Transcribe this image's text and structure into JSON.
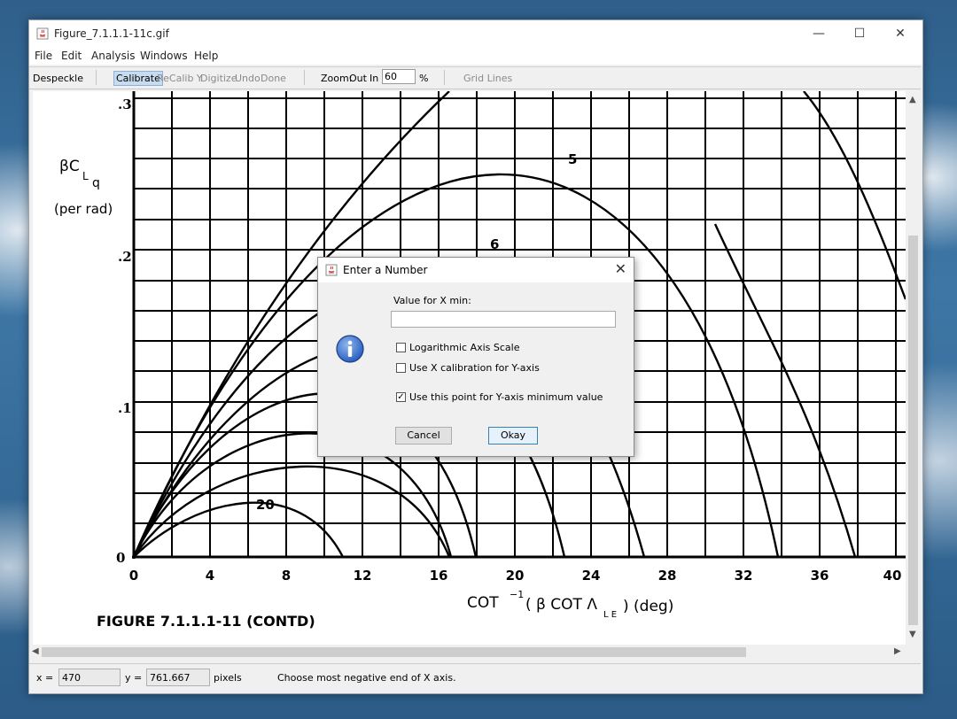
{
  "window": {
    "title": "Figure_7.1.1.1-11c.gif"
  },
  "window_controls": {
    "minimize": "—",
    "maximize": "☐",
    "close": "✕"
  },
  "menu": [
    "File",
    "Edit",
    "Analysis",
    "Windows",
    "Help"
  ],
  "toolbar": {
    "despeckle": "Despeckle",
    "calibrate": "Calibrate",
    "recalib_y": "ReCalib Y",
    "digitize": "Digitize",
    "undo": "Undo",
    "done": "Done",
    "zoom_label": "Zoom:",
    "zoom_out": "Out",
    "zoom_in": "In",
    "zoom_value": "60",
    "zoom_unit": "%",
    "grid_lines": "Grid Lines"
  },
  "figure": {
    "y_ticks": [
      ".3",
      ".2",
      ".1",
      "0"
    ],
    "x_ticks": [
      "0",
      "4",
      "8",
      "12",
      "16",
      "20",
      "24",
      "28",
      "32",
      "36",
      "40"
    ],
    "ylabel_main": "βC",
    "ylabel_sub": "L",
    "ylabel_subsub": "q",
    "ylabel_unit": "(per rad)",
    "xlabel_main": "COT",
    "xlabel_sup": "−1",
    "xlabel_rest": "( β COT Λ",
    "xlabel_sub": "L E",
    "xlabel_end": ") (deg)",
    "curve_labels": [
      "5",
      "6",
      "20"
    ],
    "caption": "FIGURE  7.1.1.1-11  (CONTD)"
  },
  "dialog": {
    "title": "Enter a Number",
    "prompt": "Value for X min:",
    "input_value": "",
    "checkboxes": [
      {
        "label": "Logarithmic Axis Scale",
        "checked": false
      },
      {
        "label": "Use X calibration for Y-axis",
        "checked": false
      },
      {
        "label": "Use this point for Y-axis minimum value",
        "checked": true
      }
    ],
    "cancel_label": "Cancel",
    "ok_label": "Okay",
    "close_glyph": "✕"
  },
  "status": {
    "x_label": "x =",
    "x_value": "470",
    "y_label": "y =",
    "y_value": "761.667",
    "unit": "pixels",
    "message": "Choose most negative end of X axis."
  },
  "icons": {
    "app": "java-cup-icon",
    "dialog_info": "info-icon"
  },
  "colors": {
    "dialog_accent": "#3c7fb1",
    "info_blue": "#2a5fbf"
  }
}
